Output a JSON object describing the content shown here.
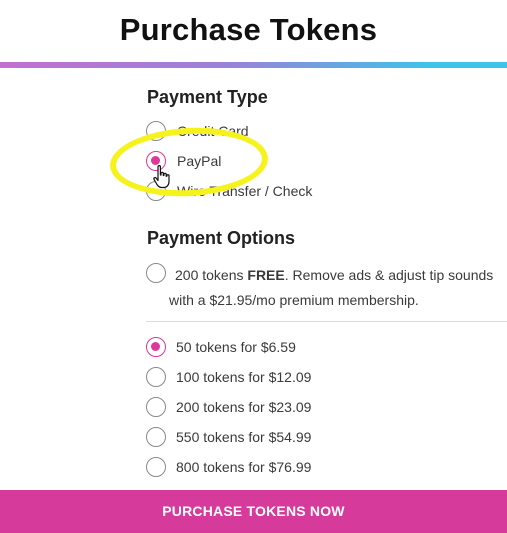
{
  "page": {
    "title": "Purchase Tokens"
  },
  "payment_type": {
    "heading": "Payment Type",
    "options": [
      {
        "label": "Credit Card",
        "selected": false
      },
      {
        "label": "PayPal",
        "selected": true
      },
      {
        "label": "Wire Transfer / Check",
        "selected": false
      }
    ]
  },
  "payment_options": {
    "heading": "Payment Options",
    "membership": {
      "amount": "200 tokens",
      "emphasis": "FREE",
      "text_rest": ". Remove ads & adjust tip sounds",
      "line2": "with a $21.95/mo premium membership.",
      "selected": false
    },
    "packages": [
      {
        "label": "50 tokens for $6.59",
        "selected": true
      },
      {
        "label": "100 tokens for $12.09",
        "selected": false
      },
      {
        "label": "200 tokens for $23.09",
        "selected": false
      },
      {
        "label": "550 tokens for $54.99",
        "selected": false
      },
      {
        "label": "800 tokens for $76.99",
        "selected": false
      }
    ]
  },
  "cta": {
    "label": "PURCHASE TOKENS NOW"
  },
  "colors": {
    "accent": "#e0359b",
    "button": "#d63a9b",
    "highlight": "#f6f21c",
    "gradient_start": "#c36fcf",
    "gradient_end": "#3ec3ea"
  },
  "icons": {
    "cursor": "hand-pointer-icon"
  }
}
